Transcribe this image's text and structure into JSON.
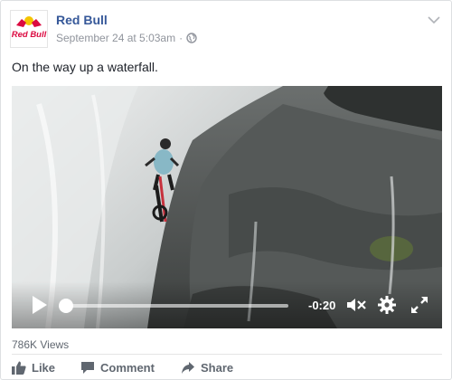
{
  "post": {
    "author": "Red Bull",
    "timestamp": "September 24 at 5:03am",
    "separator": "·",
    "audience_icon": "globe-icon",
    "text": "On the way up a waterfall."
  },
  "logo": {
    "text": "Red Bull"
  },
  "video": {
    "time_remaining": "-0:20",
    "progress": 0.03,
    "controls": [
      "play-icon",
      "mute-icon",
      "gear-icon",
      "fullscreen-icon"
    ]
  },
  "stats": {
    "views": "786K Views"
  },
  "actions": {
    "like": "Like",
    "comment": "Comment",
    "share": "Share"
  },
  "colors": {
    "link": "#365899",
    "brand_red": "#db0a40",
    "action_gray": "#606770"
  }
}
